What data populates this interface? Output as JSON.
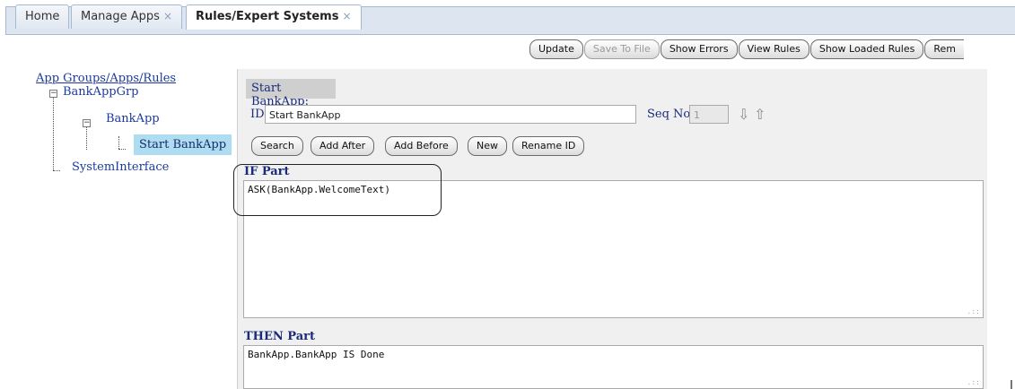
{
  "tabs": [
    {
      "label": "Home",
      "closable": false,
      "active": false
    },
    {
      "label": "Manage Apps",
      "closable": true,
      "active": false
    },
    {
      "label": "Rules/Expert Systems",
      "closable": true,
      "active": true
    }
  ],
  "tab_close_glyph": "×",
  "toolbar": {
    "update": "Update",
    "save_to_file": "Save To File",
    "show_errors": "Show Errors",
    "view_rules": "View Rules",
    "show_loaded_rules": "Show Loaded Rules",
    "remove_partial": "Rem"
  },
  "tree": {
    "root": "App Groups/Apps/Rules",
    "group": "BankAppGrp",
    "app": "BankApp",
    "rule": "Start BankApp",
    "interface": "SystemInterface"
  },
  "editor": {
    "title": "Start BankApp:",
    "id_label": "ID",
    "id_value": "Start BankApp",
    "seq_label": "Seq No:",
    "seq_value": "1",
    "actions": {
      "search": "Search",
      "add_after": "Add After",
      "add_before": "Add Before",
      "new": "New",
      "rename_id": "Rename ID"
    },
    "if_label": "IF Part",
    "if_value": "ASK(BankApp.WelcomeText)",
    "then_label": "THEN Part",
    "then_value": "BankApp.BankApp IS Done"
  },
  "icons": {
    "move_down": "arrow-down-icon",
    "move_up": "arrow-up-icon"
  },
  "colors": {
    "tree_text": "#1a3a9b",
    "selected_node": "#aedcf0",
    "panel_bg": "#f0f0f0",
    "tabstrip_bg": "#dde6f0"
  }
}
